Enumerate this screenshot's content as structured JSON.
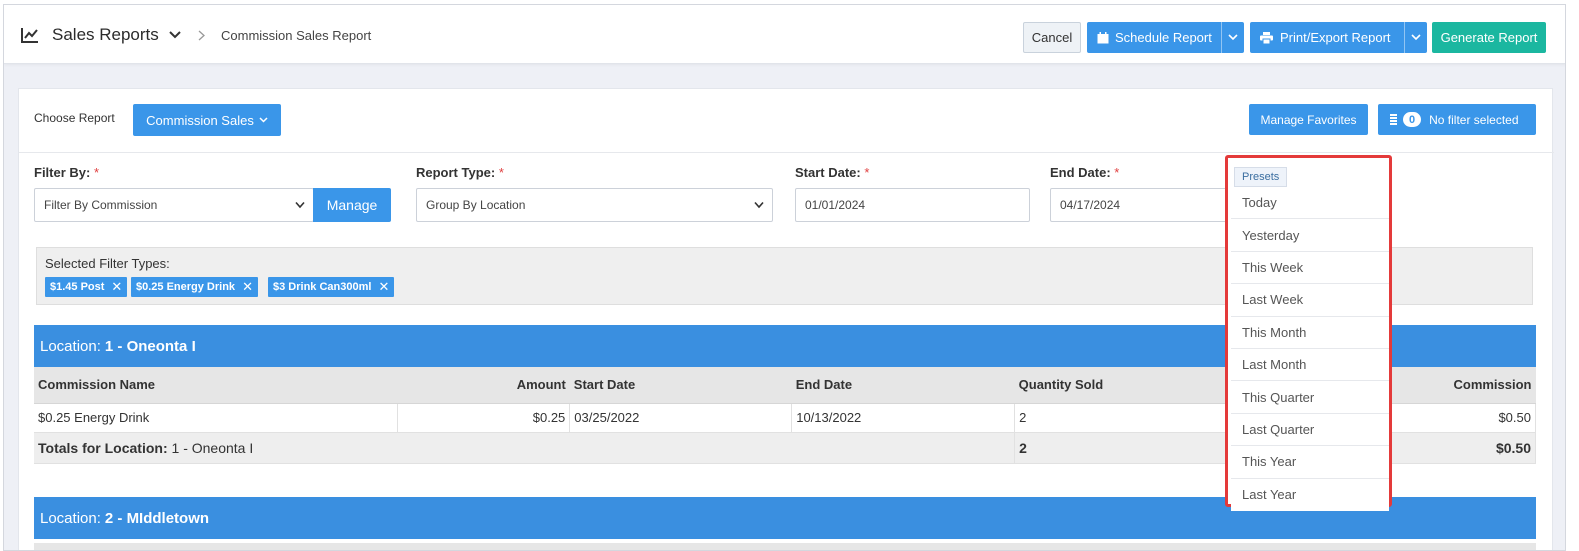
{
  "header": {
    "app_title": "Sales Reports",
    "breadcrumb": "Commission Sales Report",
    "cancel_label": "Cancel",
    "schedule_label": "Schedule Report",
    "print_label": "Print/Export Report",
    "generate_label": "Generate Report"
  },
  "toolbar": {
    "choose_label": "Choose Report",
    "report_selected": "Commission Sales",
    "favorites_label": "Manage Favorites",
    "filter_count": "0",
    "filter_status": "No filter selected"
  },
  "filters": {
    "filter_by_label": "Filter By:",
    "filter_by_value": "Filter By Commission",
    "manage_label": "Manage",
    "report_type_label": "Report Type:",
    "report_type_value": "Group By Location",
    "start_date_label": "Start Date:",
    "start_date_value": "01/01/2024",
    "end_date_label": "End Date:",
    "end_date_value": "04/17/2024",
    "required_mark": "*"
  },
  "selected_filters": {
    "title": "Selected Filter Types:",
    "chips": [
      "$1.45 Post",
      "$0.25 Energy Drink",
      "$3 Drink Can300ml"
    ],
    "remove_glyph": "✕"
  },
  "report": {
    "location_prefix": "Location:",
    "locations": [
      {
        "name": "1 - Oneonta I"
      },
      {
        "name": "2 - MIddletown"
      }
    ],
    "columns": [
      "Commission Name",
      "Amount",
      "Start Date",
      "End Date",
      "Quantity Sold",
      "Commission"
    ],
    "rows": [
      {
        "name": "$0.25 Energy Drink",
        "amount": "$0.25",
        "start": "03/25/2022",
        "end": "10/13/2022",
        "qty": "2",
        "commission": "$0.50"
      }
    ],
    "totals": {
      "label": "Totals for Location:",
      "location": "1 - Oneonta I",
      "qty": "2",
      "commission": "$0.50"
    }
  },
  "presets": {
    "tab_label": "Presets",
    "items": [
      "Today",
      "Yesterday",
      "This Week",
      "Last Week",
      "This Month",
      "Last Month",
      "This Quarter",
      "Last Quarter",
      "This Year",
      "Last Year"
    ]
  },
  "colors": {
    "primary": "#3a96e9",
    "generate": "#1bb7a0",
    "location_bar": "#3a8fe0",
    "highlight": "#e43a3a"
  }
}
